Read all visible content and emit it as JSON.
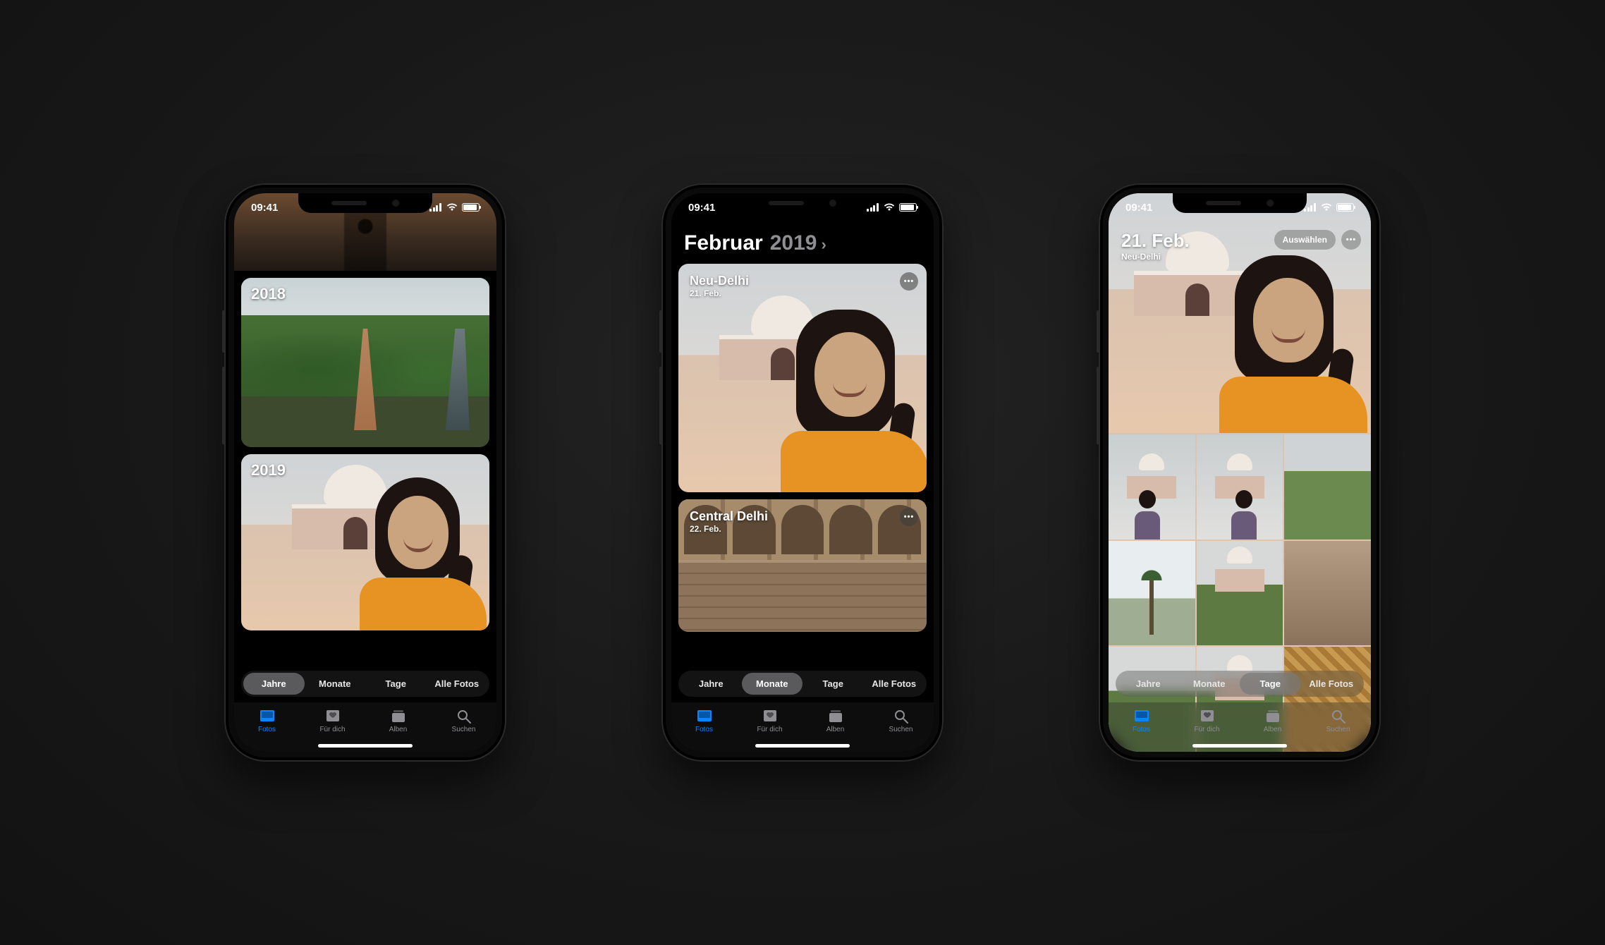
{
  "status": {
    "time": "09:41"
  },
  "segmented": {
    "years": "Jahre",
    "months": "Monate",
    "days": "Tage",
    "all": "Alle Fotos"
  },
  "tabs": {
    "photos": "Fotos",
    "for_you": "Für dich",
    "albums": "Alben",
    "search": "Suchen"
  },
  "phone1": {
    "active_segment": "years",
    "cards": {
      "y2018": "2018",
      "y2019": "2019"
    }
  },
  "phone2": {
    "active_segment": "months",
    "header": {
      "month": "Februar",
      "year": "2019"
    },
    "group1": {
      "title": "Neu-Delhi",
      "date": "21. Feb."
    },
    "group2": {
      "title": "Central Delhi",
      "date": "22. Feb."
    }
  },
  "phone3": {
    "active_segment": "days",
    "title": "21. Feb.",
    "subtitle": "Neu-Delhi",
    "select_label": "Auswählen"
  }
}
